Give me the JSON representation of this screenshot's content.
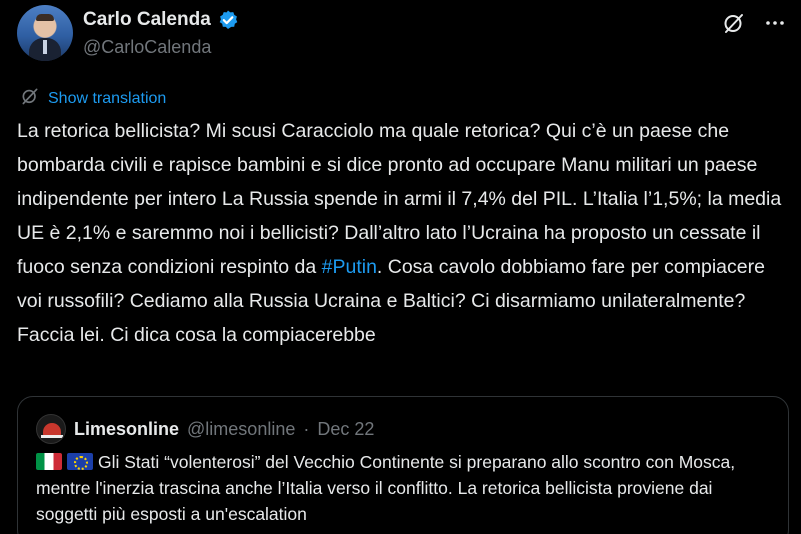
{
  "author": {
    "display_name": "Carlo Calenda",
    "handle": "@CarloCalenda",
    "verified": true
  },
  "actions": {
    "grok_icon": "grok-slash-icon",
    "more_icon": "more-dots-icon"
  },
  "translation": {
    "label": "Show translation"
  },
  "tweet": {
    "text_before_hashtag": "La retorica bellicista? Mi scusi Caracciolo ma quale retorica? Qui c’è un paese che bombarda civili e rapisce bambini e si dice pronto ad occupare Manu militari un paese indipendente per intero La Russia spende in armi il 7,4% del PIL. L’Italia l’1,5%; la media UE è 2,1% e saremmo noi i bellicisti? Dall’altro lato l’Ucraina ha proposto un cessate il fuoco senza condizioni respinto da ",
    "hashtag": "#Putin",
    "text_after_hashtag": ". Cosa cavolo dobbiamo fare per compiacere voi russofili? Cediamo alla Russia Ucraina e Baltici? Ci disarmiamo unilateralmente? Faccia lei. Ci dica cosa la compiacerebbe"
  },
  "quote": {
    "name": "Limesonline",
    "handle": "@limesonline",
    "separator": "·",
    "date": "Dec 22",
    "flags": [
      "flag-italy",
      "flag-eu"
    ],
    "text": "Gli Stati “volenterosi” del Vecchio Continente si preparano allo scontro con Mosca, mentre l'inerzia trascina anche l’Italia verso il conflitto. La retorica bellicista proviene dai soggetti più esposti a un'escalation"
  },
  "colors": {
    "background": "#000000",
    "text": "#e7e9ea",
    "secondary": "#71767b",
    "accent": "#1d9bf0",
    "border": "#2f3336"
  }
}
